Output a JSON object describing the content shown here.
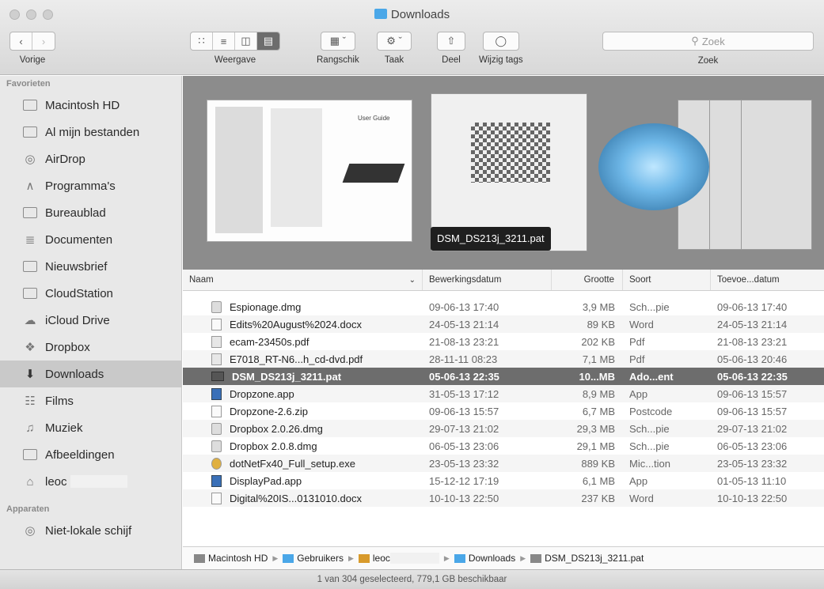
{
  "window": {
    "title": "Downloads"
  },
  "toolbar": {
    "back_label": "Vorige",
    "view_label": "Weergave",
    "arrange_label": "Rangschik",
    "action_label": "Taak",
    "share_label": "Deel",
    "tags_label": "Wijzig tags",
    "search_placeholder": "Zoek",
    "search_label": "Zoek"
  },
  "sidebar": {
    "favorites_header": "Favorieten",
    "favorites": [
      {
        "label": "Macintosh HD",
        "icon": "hard-drive-icon"
      },
      {
        "label": "Al mijn bestanden",
        "icon": "all-files-icon"
      },
      {
        "label": "AirDrop",
        "icon": "airdrop-icon"
      },
      {
        "label": "Programma's",
        "icon": "applications-icon"
      },
      {
        "label": "Bureaublad",
        "icon": "desktop-icon"
      },
      {
        "label": "Documenten",
        "icon": "documents-icon"
      },
      {
        "label": "Nieuwsbrief",
        "icon": "folder-icon"
      },
      {
        "label": "CloudStation",
        "icon": "folder-icon"
      },
      {
        "label": "iCloud Drive",
        "icon": "cloud-icon"
      },
      {
        "label": "Dropbox",
        "icon": "dropbox-icon"
      },
      {
        "label": "Downloads",
        "icon": "downloads-icon",
        "selected": true
      },
      {
        "label": "Films",
        "icon": "movies-icon"
      },
      {
        "label": "Muziek",
        "icon": "music-icon"
      },
      {
        "label": "Afbeeldingen",
        "icon": "pictures-icon"
      },
      {
        "label": "leoc",
        "icon": "home-icon"
      }
    ],
    "devices_header": "Apparaten",
    "devices": [
      {
        "label": "Niet-lokale schijf",
        "icon": "remote-disc-icon"
      }
    ]
  },
  "coverflow": {
    "tooltip": "DSM_DS213j_3211.pat",
    "doc_brand": "User Guide"
  },
  "list": {
    "columns": {
      "name": "Naam",
      "date": "Bewerkingsdatum",
      "size": "Grootte",
      "kind": "Soort",
      "added": "Toevoe...datum"
    },
    "rows": [
      {
        "name": "Espionage.dmg",
        "date": "09-06-13 17:40",
        "size": "3,9 MB",
        "kind": "Sch...pie",
        "added": "09-06-13 17:40",
        "icon": "dmg"
      },
      {
        "name": "Edits%20August%2024.docx",
        "date": "24-05-13 21:14",
        "size": "89 KB",
        "kind": "Word",
        "added": "24-05-13 21:14",
        "icon": "doc"
      },
      {
        "name": "ecam-23450s.pdf",
        "date": "21-08-13 23:21",
        "size": "202 KB",
        "kind": "Pdf",
        "added": "21-08-13 23:21",
        "icon": "pdf"
      },
      {
        "name": "E7018_RT-N6...h_cd-dvd.pdf",
        "date": "28-11-11 08:23",
        "size": "7,1 MB",
        "kind": "Pdf",
        "added": "05-06-13 20:46",
        "icon": "pdf"
      },
      {
        "name": "DSM_DS213j_3211.pat",
        "date": "05-06-13 22:35",
        "size": "10...MB",
        "kind": "Ado...ent",
        "added": "05-06-13 22:35",
        "icon": "pat",
        "selected": true
      },
      {
        "name": "Dropzone.app",
        "date": "31-05-13 17:12",
        "size": "8,9 MB",
        "kind": "App",
        "added": "09-06-13 15:57",
        "icon": "app"
      },
      {
        "name": "Dropzone-2.6.zip",
        "date": "09-06-13 15:57",
        "size": "6,7 MB",
        "kind": "Postcode",
        "added": "09-06-13 15:57",
        "icon": "zip"
      },
      {
        "name": "Dropbox 2.0.26.dmg",
        "date": "29-07-13 21:02",
        "size": "29,3 MB",
        "kind": "Sch...pie",
        "added": "29-07-13 21:02",
        "icon": "dmg"
      },
      {
        "name": "Dropbox 2.0.8.dmg",
        "date": "06-05-13 23:06",
        "size": "29,1 MB",
        "kind": "Sch...pie",
        "added": "06-05-13 23:06",
        "icon": "dmg"
      },
      {
        "name": "dotNetFx40_Full_setup.exe",
        "date": "23-05-13 23:32",
        "size": "889 KB",
        "kind": "Mic...tion",
        "added": "23-05-13 23:32",
        "icon": "exe"
      },
      {
        "name": "DisplayPad.app",
        "date": "15-12-12 17:19",
        "size": "6,1 MB",
        "kind": "App",
        "added": "01-05-13 11:10",
        "icon": "app"
      },
      {
        "name": "Digital%20IS...0131010.docx",
        "date": "10-10-13 22:50",
        "size": "237 KB",
        "kind": "Word",
        "added": "10-10-13 22:50",
        "icon": "doc"
      }
    ]
  },
  "pathbar": {
    "items": [
      "Macintosh HD",
      "Gebruikers",
      "leoc",
      "Downloads",
      "DSM_DS213j_3211.pat"
    ]
  },
  "status": {
    "text": "1 van 304 geselecteerd, 779,1 GB beschikbaar"
  }
}
